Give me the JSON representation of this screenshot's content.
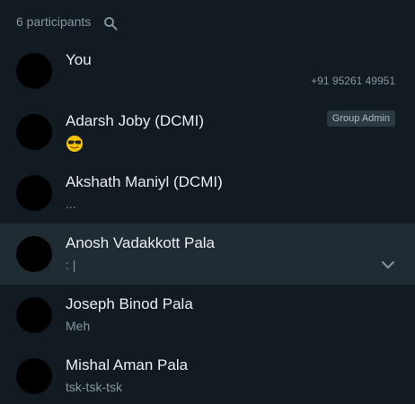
{
  "header": {
    "participants_count": "6 participants",
    "search_icon": "search-icon"
  },
  "participants": [
    {
      "name": "You",
      "status": "",
      "phone": "+91 95261 49951",
      "badge": ""
    },
    {
      "name": "Adarsh Joby (DCMI)",
      "status_emoji": "sunglasses-emoji",
      "badge": "Group Admin"
    },
    {
      "name": "Akshath Maniyl (DCMI)",
      "status": "..."
    },
    {
      "name": "Anosh Vadakkott Pala",
      "status": ": |",
      "hovered": true,
      "action_icon": "chevron-down-icon"
    },
    {
      "name": "Joseph Binod Pala",
      "status": "Meh"
    },
    {
      "name": "Mishal Aman Pala",
      "status": "tsk-tsk-tsk"
    }
  ],
  "colors": {
    "background": "#111b21",
    "hover": "#202c33",
    "primary_text": "#e9edef",
    "secondary_text": "#8696a0"
  }
}
